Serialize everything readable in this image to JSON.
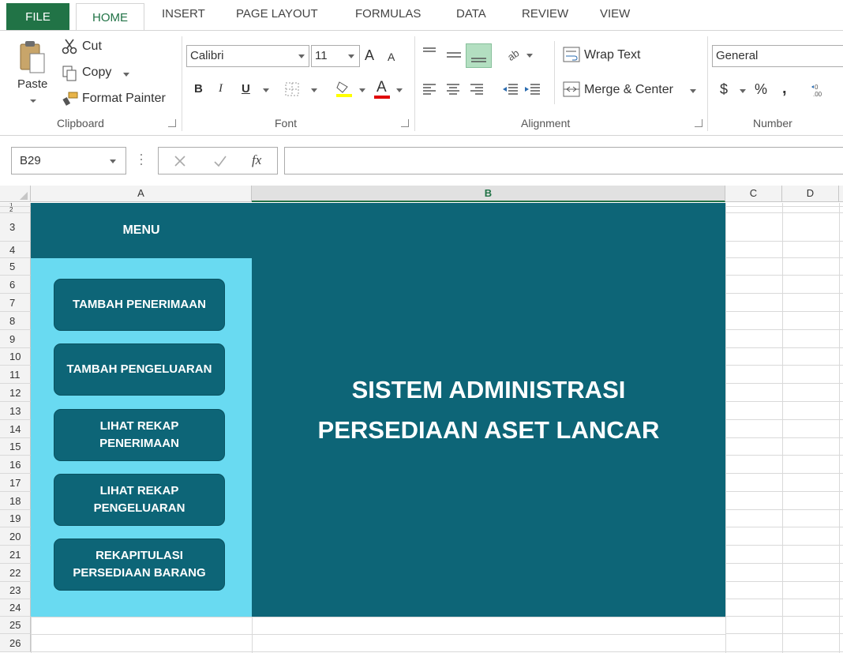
{
  "tabs": {
    "file": "FILE",
    "home": "HOME",
    "insert": "INSERT",
    "page_layout": "PAGE LAYOUT",
    "formulas": "FORMULAS",
    "data": "DATA",
    "review": "REVIEW",
    "view": "VIEW"
  },
  "clipboard": {
    "paste": "Paste",
    "cut": "Cut",
    "copy": "Copy",
    "format_painter": "Format Painter",
    "label": "Clipboard"
  },
  "font": {
    "name": "Calibri",
    "size": "11",
    "grow": "A",
    "shrink": "A",
    "bold": "B",
    "italic": "I",
    "underline": "U",
    "font_color": "A",
    "label": "Font"
  },
  "alignment": {
    "wrap_text": "Wrap Text",
    "merge_center": "Merge & Center",
    "label": "Alignment"
  },
  "number": {
    "format": "General",
    "currency": "$",
    "percent": "%",
    "comma": ",",
    "label": "Number"
  },
  "formula_bar": {
    "name_box": "B29",
    "fx": "fx",
    "value": ""
  },
  "columns": [
    "A",
    "B",
    "C",
    "D"
  ],
  "rows": [
    "1",
    "2",
    "3",
    "4",
    "5",
    "6",
    "7",
    "8",
    "9",
    "10",
    "11",
    "12",
    "13",
    "14",
    "15",
    "16",
    "17",
    "18",
    "19",
    "20",
    "21",
    "22",
    "23",
    "24",
    "25",
    "26"
  ],
  "sheet": {
    "menu_title": "MENU",
    "buttons": [
      "TAMBAH PENERIMAAN",
      "TAMBAH PENGELUARAN",
      "LIHAT REKAP\nPENERIMAAN",
      "LIHAT REKAP\nPENGELUARAN",
      "REKAPITULASI\nPERSEDIAAN BARANG"
    ],
    "title_line1": "SISTEM ADMINISTRASI",
    "title_line2": "PERSEDIAAN ASET LANCAR"
  },
  "colors": {
    "excel_green": "#217346",
    "dark_teal": "#0d6577",
    "light_cyan": "#69daf1"
  }
}
